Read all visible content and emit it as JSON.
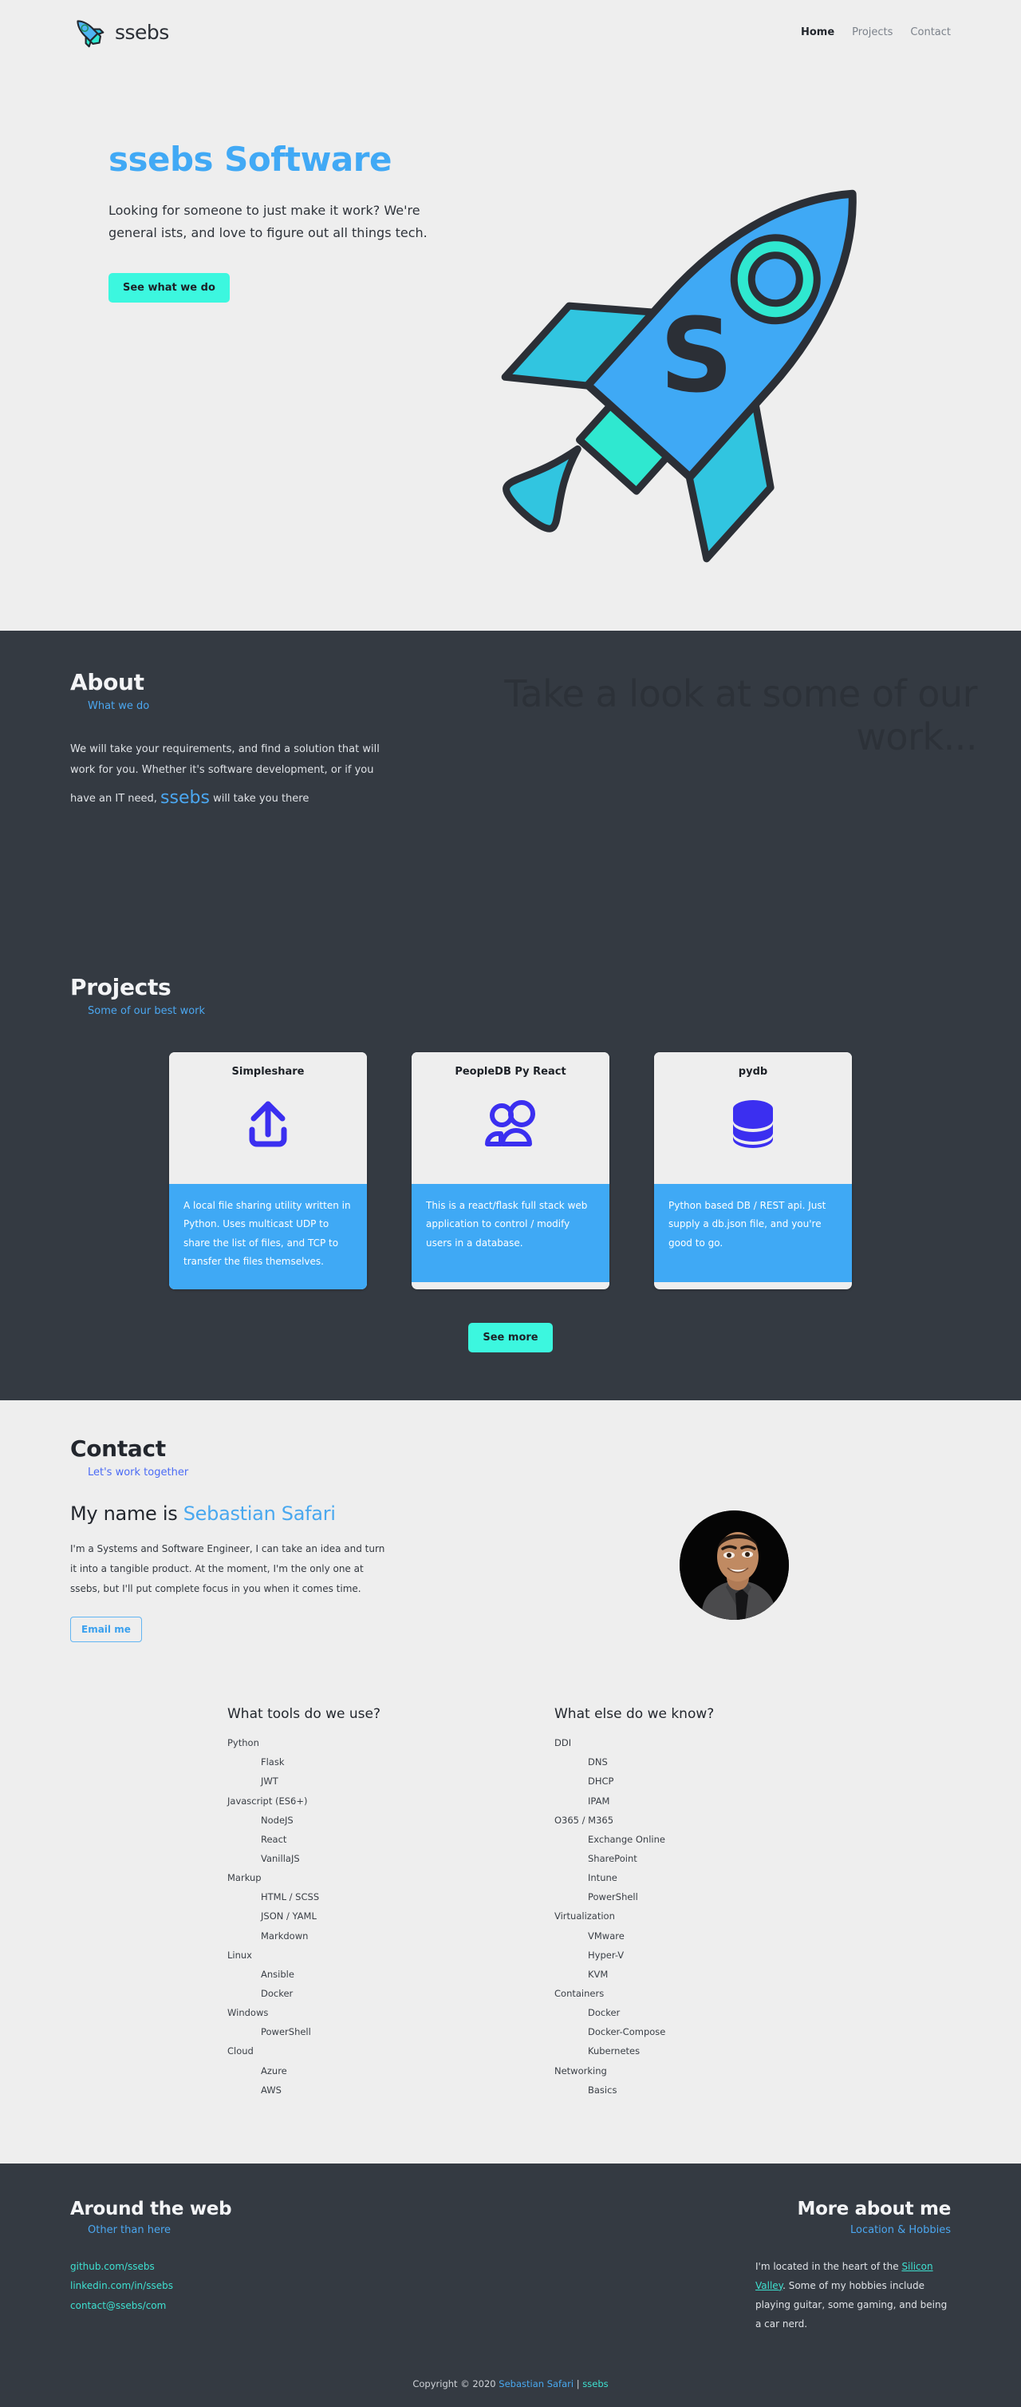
{
  "header": {
    "logo_icon": "rocket-icon",
    "brand": "ssebs",
    "nav": [
      {
        "label": "Home",
        "active": true
      },
      {
        "label": "Projects",
        "active": false
      },
      {
        "label": "Contact",
        "active": false
      }
    ]
  },
  "hero": {
    "title": "ssebs Software",
    "paragraph": "Looking for someone to just make it work? We're general ists, and love to figure out all things tech.",
    "cta": "See what we do",
    "cta_color": "#3cf7df",
    "illustration": "rocket-illustration",
    "rocket_letter": "S"
  },
  "about": {
    "title": "About",
    "subtitle": "What we do",
    "body_part1": "We will take your requirements, and find a solution that will work for you. Whether it's software development, or if you have an IT need,",
    "body_accent": "ssebs",
    "body_part2": "will take you there",
    "big_quote": "Take a look at some of our work...",
    "accent_color": "#4ba7f0"
  },
  "projects": {
    "title": "Projects",
    "subtitle": "Some of our best work",
    "see_more": "See more",
    "cards": [
      {
        "title": "Simpleshare",
        "icon": "upload-icon",
        "description": "A local file sharing utility written in Python. Uses multicast UDP to share the list of files, and TCP to transfer the files themselves."
      },
      {
        "title": "PeopleDB Py React",
        "icon": "people-icon",
        "description": "This is a react/flask full stack web application to control / modify users in a database."
      },
      {
        "title": "pydb",
        "icon": "database-icon",
        "description": "Python based DB / REST api. Just supply a db.json file, and you're good to go."
      }
    ],
    "card_body_color": "#3fa9f5",
    "card_icon_color": "#3b2ff0"
  },
  "contact": {
    "title": "Contact",
    "subtitle": "Let's work together",
    "name_prefix": "My name is ",
    "name": "Sebastian Safari",
    "paragraph": "I'm a Systems and Software Engineer, I can take an idea and turn it into a tangible product. At the moment, I'm the only one at ssebs, but I'll put complete focus in you when it comes time.",
    "email_button": "Email me",
    "portrait": "profile-photo"
  },
  "skills": {
    "left": {
      "heading": "What tools do we use?",
      "groups": [
        {
          "name": "Python",
          "items": [
            "Flask",
            "JWT"
          ]
        },
        {
          "name": "Javascript (ES6+)",
          "items": [
            "NodeJS",
            "React",
            "VanillaJS"
          ]
        },
        {
          "name": "Markup",
          "items": [
            "HTML / SCSS",
            "JSON / YAML",
            "Markdown"
          ]
        },
        {
          "name": "Linux",
          "items": [
            "Ansible",
            "Docker"
          ]
        },
        {
          "name": "Windows",
          "items": [
            "PowerShell"
          ]
        },
        {
          "name": "Cloud",
          "items": [
            "Azure",
            "AWS"
          ]
        }
      ]
    },
    "right": {
      "heading": "What else do we know?",
      "groups": [
        {
          "name": "DDI",
          "items": [
            "DNS",
            "DHCP",
            "IPAM"
          ]
        },
        {
          "name": "O365 / M365",
          "items": [
            "Exchange Online",
            "SharePoint",
            "Intune",
            "PowerShell"
          ]
        },
        {
          "name": "Virtualization",
          "items": [
            "VMware",
            "Hyper-V",
            "KVM"
          ]
        },
        {
          "name": "Containers",
          "items": [
            "Docker",
            "Docker-Compose",
            "Kubernetes"
          ]
        },
        {
          "name": "Networking",
          "items": [
            "Basics"
          ]
        }
      ]
    }
  },
  "footer": {
    "left": {
      "title": "Around the web",
      "subtitle": "Other than here",
      "links": [
        "github.com/ssebs",
        "linkedin.com/in/ssebs",
        "contact@ssebs/com"
      ]
    },
    "right": {
      "title": "More about me",
      "subtitle": "Location & Hobbies",
      "text_before": "I'm located in the heart of the ",
      "location": "Silicon Valley",
      "text_after": ". Some of my hobbies include playing guitar, some gaming, and being a car nerd."
    },
    "copyright_prefix": "Copyright © 2020 ",
    "copyright_name": "Sebastian Safari",
    "copyright_sep": " | ",
    "copyright_brand": "ssebs",
    "link_color": "#3ee0d0"
  }
}
